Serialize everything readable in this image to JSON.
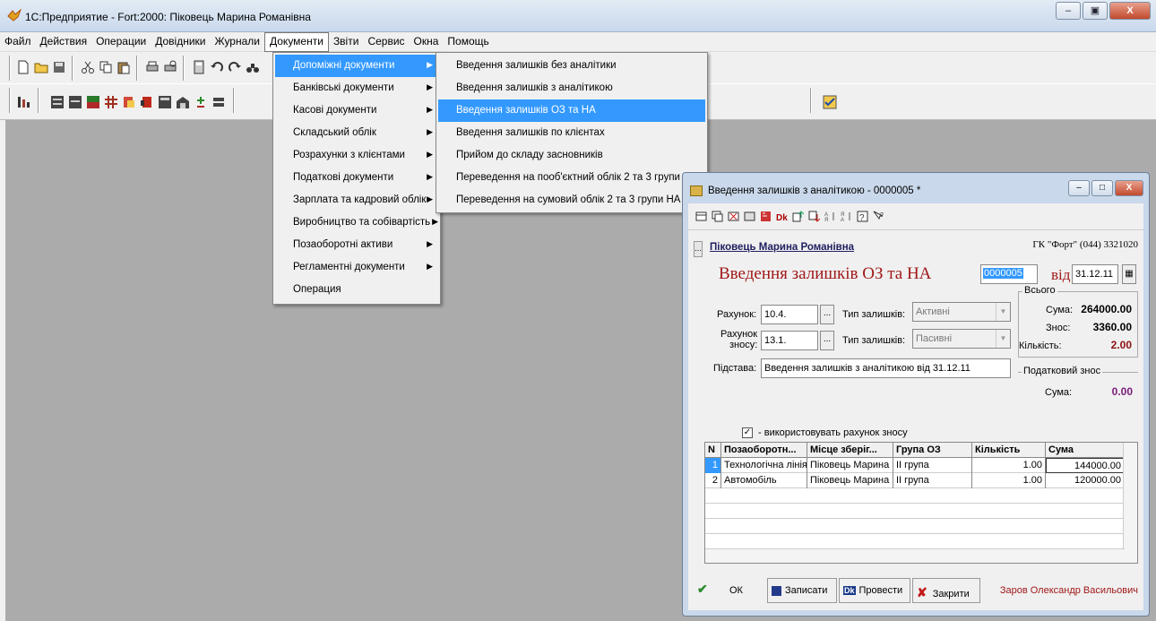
{
  "app": {
    "title": "1С:Предприятие - Fort:2000: Піковець Марина Романівна"
  },
  "menubar": [
    "Файл",
    "Действия",
    "Операции",
    "Довідники",
    "Журнали",
    "Документи",
    "Звіти",
    "Сервис",
    "Окна",
    "Помощь"
  ],
  "documents_menu": [
    {
      "label": "Допоміжні документи",
      "submenu": true
    },
    {
      "label": "Банківські документи",
      "submenu": true
    },
    {
      "label": "Касові документи",
      "submenu": true
    },
    {
      "label": "Складський облік",
      "submenu": true
    },
    {
      "label": "Розрахунки з клієнтами",
      "submenu": true
    },
    {
      "label": "Податкові документи",
      "submenu": true
    },
    {
      "label": "Зарплата та кадровий облік",
      "submenu": true
    },
    {
      "label": "Виробництво та собівартість",
      "submenu": true
    },
    {
      "label": "Позаоборотні активи",
      "submenu": true
    },
    {
      "label": "Регламентні документи",
      "submenu": true
    },
    {
      "label": "Операция",
      "submenu": false
    }
  ],
  "aux_menu": [
    "Введення залишків без аналітики",
    "Введення залишків з аналітикою",
    "Введення залишків ОЗ та НА",
    "Введення залишків по клієнтах",
    "Прийом до складу засновників",
    "Переведення на пооб'єктний облік 2 та 3 групи НА",
    "Переведення на сумовий облік 2 та 3 групи НА"
  ],
  "doc": {
    "window_title": "Введення залишків з аналітикою - 0000005 *",
    "org": "Піковець Марина Романівна",
    "firm": "ГК \"Форт\" (044) 3321020",
    "heading": "Введення залишків ОЗ та НА",
    "number": "0000005",
    "vid": "від",
    "date": "31.12.11",
    "account_label": "Рахунок:",
    "account": "10.4.",
    "balance_type_label": "Тип залишків:",
    "balance_type": "Активні",
    "wear_account_label_1": "Рахунок",
    "wear_account_label_2": "зносу:",
    "wear_account": "13.1.",
    "wear_balance_type": "Пасивні",
    "basis_label": "Підстава:",
    "basis": "Введення залишків з аналітикою від 31.12.11",
    "use_wear_label": "- використовувать рахунок зносу",
    "totals": {
      "caption": "Всього",
      "sum_label": "Сума:",
      "sum": "264000.00",
      "wear_label": "Знос:",
      "wear": "3360.00",
      "qty_label": "Кількість:",
      "qty": "2.00",
      "tax_caption": "Податковий знос",
      "tax_sum_label": "Сума:",
      "tax_sum": "0.00"
    },
    "table": {
      "headers": [
        "N",
        "Позаоборотн...",
        "Місце зберіг...",
        "Група ОЗ",
        "Кількість",
        "Сума"
      ],
      "rows": [
        [
          "1",
          "Технологічна лінія",
          "Піковець Марина",
          "ІІ група",
          "1.00",
          "144000.00"
        ],
        [
          "2",
          "Автомобіль",
          "Піковець Марина",
          "ІІ група",
          "1.00",
          "120000.00"
        ]
      ]
    },
    "buttons": {
      "ok": "ОК",
      "save": "Записати",
      "post": "Провести",
      "close": "Закрити"
    },
    "author": "Зарoв Олександр Васильович"
  }
}
